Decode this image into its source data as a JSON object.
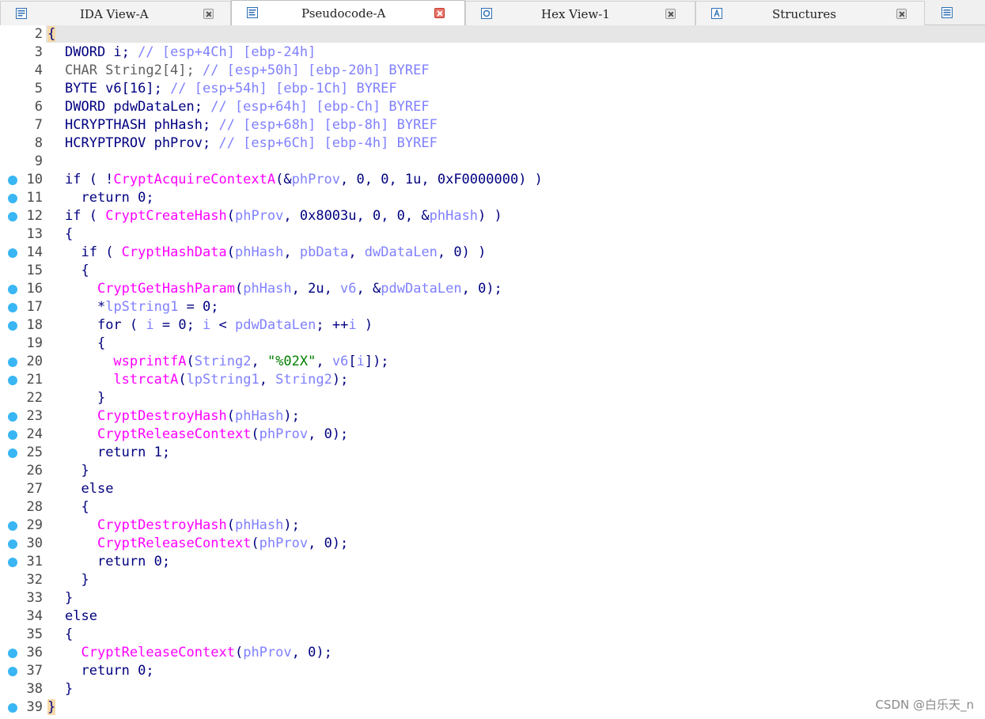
{
  "tabs": [
    {
      "label": "IDA View-A",
      "active": false,
      "icon": "ida-view-icon"
    },
    {
      "label": "Pseudocode-A",
      "active": true,
      "icon": "pseudocode-icon"
    },
    {
      "label": "Hex View-1",
      "active": false,
      "icon": "hex-view-icon"
    },
    {
      "label": "Structures",
      "active": false,
      "icon": "structures-icon"
    }
  ],
  "colors": {
    "keyword": "#000080",
    "comment": "#8080ff",
    "function": "#ff00ff",
    "variable": "#8080ff",
    "string": "#008000",
    "breakpoint_dot": "#39b6f3"
  },
  "code": [
    {
      "ln": "2",
      "dot": false,
      "indent": 0,
      "tokens": [
        [
          "b",
          "{"
        ]
      ]
    },
    {
      "ln": "3",
      "dot": false,
      "indent": 2,
      "tokens": [
        [
          "k",
          "DWORD i; "
        ],
        [
          "c",
          "// [esp+4Ch] [ebp-24h]"
        ]
      ]
    },
    {
      "ln": "4",
      "dot": false,
      "indent": 2,
      "tokens": [
        [
          "tg",
          "CHAR String2[4]; "
        ],
        [
          "c",
          "// [esp+50h] [ebp-20h] BYREF"
        ]
      ]
    },
    {
      "ln": "5",
      "dot": false,
      "indent": 2,
      "tokens": [
        [
          "k",
          "BYTE v6[16]; "
        ],
        [
          "c",
          "// [esp+54h] [ebp-1Ch] BYREF"
        ]
      ]
    },
    {
      "ln": "6",
      "dot": false,
      "indent": 2,
      "tokens": [
        [
          "k",
          "DWORD pdwDataLen; "
        ],
        [
          "c",
          "// [esp+64h] [ebp-Ch] BYREF"
        ]
      ]
    },
    {
      "ln": "7",
      "dot": false,
      "indent": 2,
      "tokens": [
        [
          "k",
          "HCRYPTHASH phHash; "
        ],
        [
          "c",
          "// [esp+68h] [ebp-8h] BYREF"
        ]
      ]
    },
    {
      "ln": "8",
      "dot": false,
      "indent": 2,
      "tokens": [
        [
          "k",
          "HCRYPTPROV phProv; "
        ],
        [
          "c",
          "// [esp+6Ch] [ebp-4h] BYREF"
        ]
      ]
    },
    {
      "ln": "9",
      "dot": false,
      "indent": 0,
      "tokens": []
    },
    {
      "ln": "10",
      "dot": true,
      "indent": 2,
      "tokens": [
        [
          "k",
          "if ( !"
        ],
        [
          "f",
          "CryptAcquireContextA"
        ],
        [
          "k",
          "(&"
        ],
        [
          "v",
          "phProv"
        ],
        [
          "k",
          ", 0, 0, 1u, 0xF0000000) )"
        ]
      ]
    },
    {
      "ln": "11",
      "dot": true,
      "indent": 4,
      "tokens": [
        [
          "k",
          "return 0;"
        ]
      ]
    },
    {
      "ln": "12",
      "dot": true,
      "indent": 2,
      "tokens": [
        [
          "k",
          "if ( "
        ],
        [
          "f",
          "CryptCreateHash"
        ],
        [
          "k",
          "("
        ],
        [
          "v",
          "phProv"
        ],
        [
          "k",
          ", 0x8003u, 0, 0, &"
        ],
        [
          "v",
          "phHash"
        ],
        [
          "k",
          ") )"
        ]
      ]
    },
    {
      "ln": "13",
      "dot": false,
      "indent": 2,
      "tokens": [
        [
          "k",
          "{"
        ]
      ]
    },
    {
      "ln": "14",
      "dot": true,
      "indent": 4,
      "tokens": [
        [
          "k",
          "if ( "
        ],
        [
          "f",
          "CryptHashData"
        ],
        [
          "k",
          "("
        ],
        [
          "v",
          "phHash"
        ],
        [
          "k",
          ", "
        ],
        [
          "v",
          "pbData"
        ],
        [
          "k",
          ", "
        ],
        [
          "v",
          "dwDataLen"
        ],
        [
          "k",
          ", 0) )"
        ]
      ]
    },
    {
      "ln": "15",
      "dot": false,
      "indent": 4,
      "tokens": [
        [
          "k",
          "{"
        ]
      ]
    },
    {
      "ln": "16",
      "dot": true,
      "indent": 6,
      "tokens": [
        [
          "f",
          "CryptGetHashParam"
        ],
        [
          "k",
          "("
        ],
        [
          "v",
          "phHash"
        ],
        [
          "k",
          ", 2u, "
        ],
        [
          "v",
          "v6"
        ],
        [
          "k",
          ", &"
        ],
        [
          "v",
          "pdwDataLen"
        ],
        [
          "k",
          ", 0);"
        ]
      ]
    },
    {
      "ln": "17",
      "dot": true,
      "indent": 6,
      "tokens": [
        [
          "k",
          "*"
        ],
        [
          "v",
          "lpString1"
        ],
        [
          "k",
          " = 0;"
        ]
      ]
    },
    {
      "ln": "18",
      "dot": true,
      "indent": 6,
      "tokens": [
        [
          "k",
          "for ( "
        ],
        [
          "v",
          "i"
        ],
        [
          "k",
          " = 0; "
        ],
        [
          "v",
          "i"
        ],
        [
          "k",
          " < "
        ],
        [
          "v",
          "pdwDataLen"
        ],
        [
          "k",
          "; ++"
        ],
        [
          "v",
          "i"
        ],
        [
          "k",
          " )"
        ]
      ]
    },
    {
      "ln": "19",
      "dot": false,
      "indent": 6,
      "tokens": [
        [
          "k",
          "{"
        ]
      ]
    },
    {
      "ln": "20",
      "dot": true,
      "indent": 8,
      "tokens": [
        [
          "f",
          "wsprintfA"
        ],
        [
          "k",
          "("
        ],
        [
          "v",
          "String2"
        ],
        [
          "k",
          ", "
        ],
        [
          "s",
          "\"%02X\""
        ],
        [
          "k",
          ", "
        ],
        [
          "v",
          "v6"
        ],
        [
          "k",
          "["
        ],
        [
          "v",
          "i"
        ],
        [
          "k",
          "]);"
        ]
      ]
    },
    {
      "ln": "21",
      "dot": true,
      "indent": 8,
      "tokens": [
        [
          "f",
          "lstrcatA"
        ],
        [
          "k",
          "("
        ],
        [
          "v",
          "lpString1"
        ],
        [
          "k",
          ", "
        ],
        [
          "v",
          "String2"
        ],
        [
          "k",
          ");"
        ]
      ]
    },
    {
      "ln": "22",
      "dot": false,
      "indent": 6,
      "tokens": [
        [
          "k",
          "}"
        ]
      ]
    },
    {
      "ln": "23",
      "dot": true,
      "indent": 6,
      "tokens": [
        [
          "f",
          "CryptDestroyHash"
        ],
        [
          "k",
          "("
        ],
        [
          "v",
          "phHash"
        ],
        [
          "k",
          ");"
        ]
      ]
    },
    {
      "ln": "24",
      "dot": true,
      "indent": 6,
      "tokens": [
        [
          "f",
          "CryptReleaseContext"
        ],
        [
          "k",
          "("
        ],
        [
          "v",
          "phProv"
        ],
        [
          "k",
          ", 0);"
        ]
      ]
    },
    {
      "ln": "25",
      "dot": true,
      "indent": 6,
      "tokens": [
        [
          "k",
          "return 1;"
        ]
      ]
    },
    {
      "ln": "26",
      "dot": false,
      "indent": 4,
      "tokens": [
        [
          "k",
          "}"
        ]
      ]
    },
    {
      "ln": "27",
      "dot": false,
      "indent": 4,
      "tokens": [
        [
          "k",
          "else"
        ]
      ]
    },
    {
      "ln": "28",
      "dot": false,
      "indent": 4,
      "tokens": [
        [
          "k",
          "{"
        ]
      ]
    },
    {
      "ln": "29",
      "dot": true,
      "indent": 6,
      "tokens": [
        [
          "f",
          "CryptDestroyHash"
        ],
        [
          "k",
          "("
        ],
        [
          "v",
          "phHash"
        ],
        [
          "k",
          ");"
        ]
      ]
    },
    {
      "ln": "30",
      "dot": true,
      "indent": 6,
      "tokens": [
        [
          "f",
          "CryptReleaseContext"
        ],
        [
          "k",
          "("
        ],
        [
          "v",
          "phProv"
        ],
        [
          "k",
          ", 0);"
        ]
      ]
    },
    {
      "ln": "31",
      "dot": true,
      "indent": 6,
      "tokens": [
        [
          "k",
          "return 0;"
        ]
      ]
    },
    {
      "ln": "32",
      "dot": false,
      "indent": 4,
      "tokens": [
        [
          "k",
          "}"
        ]
      ]
    },
    {
      "ln": "33",
      "dot": false,
      "indent": 2,
      "tokens": [
        [
          "k",
          "}"
        ]
      ]
    },
    {
      "ln": "34",
      "dot": false,
      "indent": 2,
      "tokens": [
        [
          "k",
          "else"
        ]
      ]
    },
    {
      "ln": "35",
      "dot": false,
      "indent": 2,
      "tokens": [
        [
          "k",
          "{"
        ]
      ]
    },
    {
      "ln": "36",
      "dot": true,
      "indent": 4,
      "tokens": [
        [
          "f",
          "CryptReleaseContext"
        ],
        [
          "k",
          "("
        ],
        [
          "v",
          "phProv"
        ],
        [
          "k",
          ", 0);"
        ]
      ]
    },
    {
      "ln": "37",
      "dot": true,
      "indent": 4,
      "tokens": [
        [
          "k",
          "return 0;"
        ]
      ]
    },
    {
      "ln": "38",
      "dot": false,
      "indent": 2,
      "tokens": [
        [
          "k",
          "}"
        ]
      ]
    },
    {
      "ln": "39",
      "dot": true,
      "indent": 0,
      "tokens": [
        [
          "b",
          "}"
        ]
      ]
    }
  ],
  "watermark": "CSDN @白乐天_n"
}
